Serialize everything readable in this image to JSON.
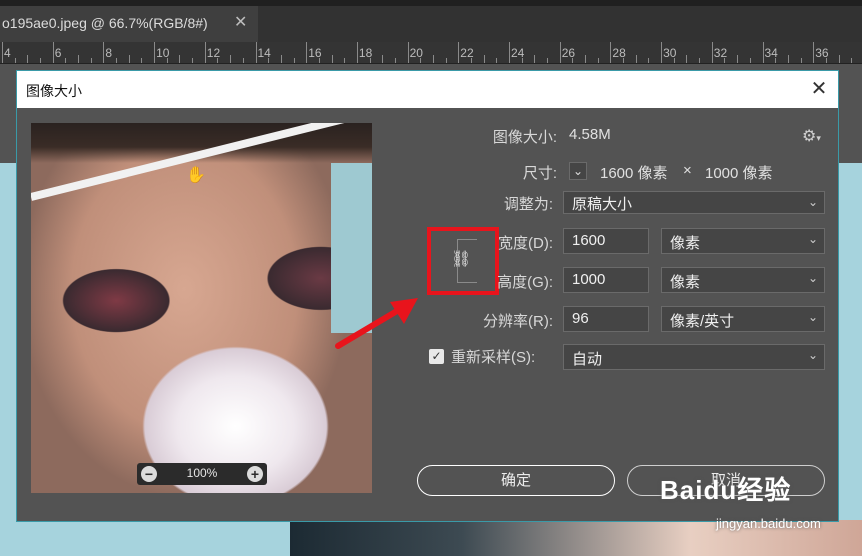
{
  "document_tab": {
    "title": "o195ae0.jpeg @ 66.7%(RGB/8#)",
    "close": "✕"
  },
  "ruler": {
    "labels": [
      "4",
      "6",
      "8",
      "10",
      "12",
      "14",
      "16",
      "18",
      "20",
      "22",
      "24",
      "26",
      "28",
      "30",
      "32",
      "34",
      "36"
    ]
  },
  "dialog": {
    "title": "图像大小",
    "close": "✕",
    "preview": {
      "zoom": "100%",
      "zoom_in": "+",
      "zoom_out": "−"
    },
    "image_size": {
      "label": "图像大小:",
      "value": "4.58M"
    },
    "dimensions": {
      "label": "尺寸:",
      "width": "1600 像素",
      "times": "×",
      "height": "1000 像素"
    },
    "fit_to": {
      "label": "调整为:",
      "value": "原稿大小"
    },
    "width": {
      "label": "宽度(D):",
      "value": "1600",
      "unit": "像素"
    },
    "height": {
      "label": "高度(G):",
      "value": "1000",
      "unit": "像素"
    },
    "resolution": {
      "label": "分辨率(R):",
      "value": "96",
      "unit": "像素/英寸"
    },
    "resample": {
      "label": "重新采样(S):",
      "checked": true,
      "value": "自动"
    },
    "buttons": {
      "ok": "确定",
      "cancel": "取消"
    }
  },
  "watermark": {
    "brand": "Baidu经验",
    "url": "jingyan.baidu.com"
  },
  "colors": {
    "accent_red": "#e8141c",
    "dialog_bg": "#535353",
    "photo_bg": "#a6d3dd"
  }
}
